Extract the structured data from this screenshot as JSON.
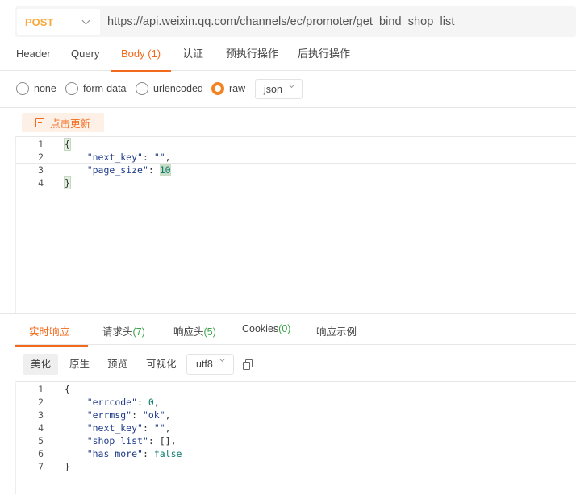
{
  "request": {
    "method": "POST",
    "url": "https://api.weixin.qq.com/channels/ec/promoter/get_bind_shop_list"
  },
  "request_tabs": [
    "Header",
    "Query",
    "Body (1)",
    "认证",
    "预执行操作",
    "后执行操作"
  ],
  "body_types": [
    "none",
    "form-data",
    "urlencoded",
    "raw"
  ],
  "body_format": "json",
  "update_button": "点击更新",
  "request_body": {
    "line_numbers": [
      "1",
      "2",
      "3",
      "4"
    ],
    "open_brace": "{",
    "key1": "\"next_key\"",
    "val1": "\"\"",
    "key2": "\"page_size\"",
    "val2": "10",
    "close_brace": "}"
  },
  "response_tabs": {
    "realtime": "实时响应",
    "req_headers": "请求头",
    "req_headers_count": "(7)",
    "resp_headers": "响应头",
    "resp_headers_count": "(5)",
    "cookies": "Cookies",
    "cookies_count": "(0)",
    "example": "响应示例"
  },
  "view_options": [
    "美化",
    "原生",
    "预览",
    "可视化"
  ],
  "encoding": "utf8",
  "response_body": {
    "line_numbers": [
      "1",
      "2",
      "3",
      "4",
      "5",
      "6",
      "7"
    ],
    "open_brace": "{",
    "errcode_key": "\"errcode\"",
    "errcode_val": "0",
    "errmsg_key": "\"errmsg\"",
    "errmsg_val": "\"ok\"",
    "next_key_key": "\"next_key\"",
    "next_key_val": "\"\"",
    "shop_list_key": "\"shop_list\"",
    "shop_list_val": "[]",
    "has_more_key": "\"has_more\"",
    "has_more_val": "false",
    "close_brace": "}"
  },
  "colors": {
    "accent": "#f26b1d",
    "method": "#f7a93c",
    "count": "#3aa34a"
  }
}
